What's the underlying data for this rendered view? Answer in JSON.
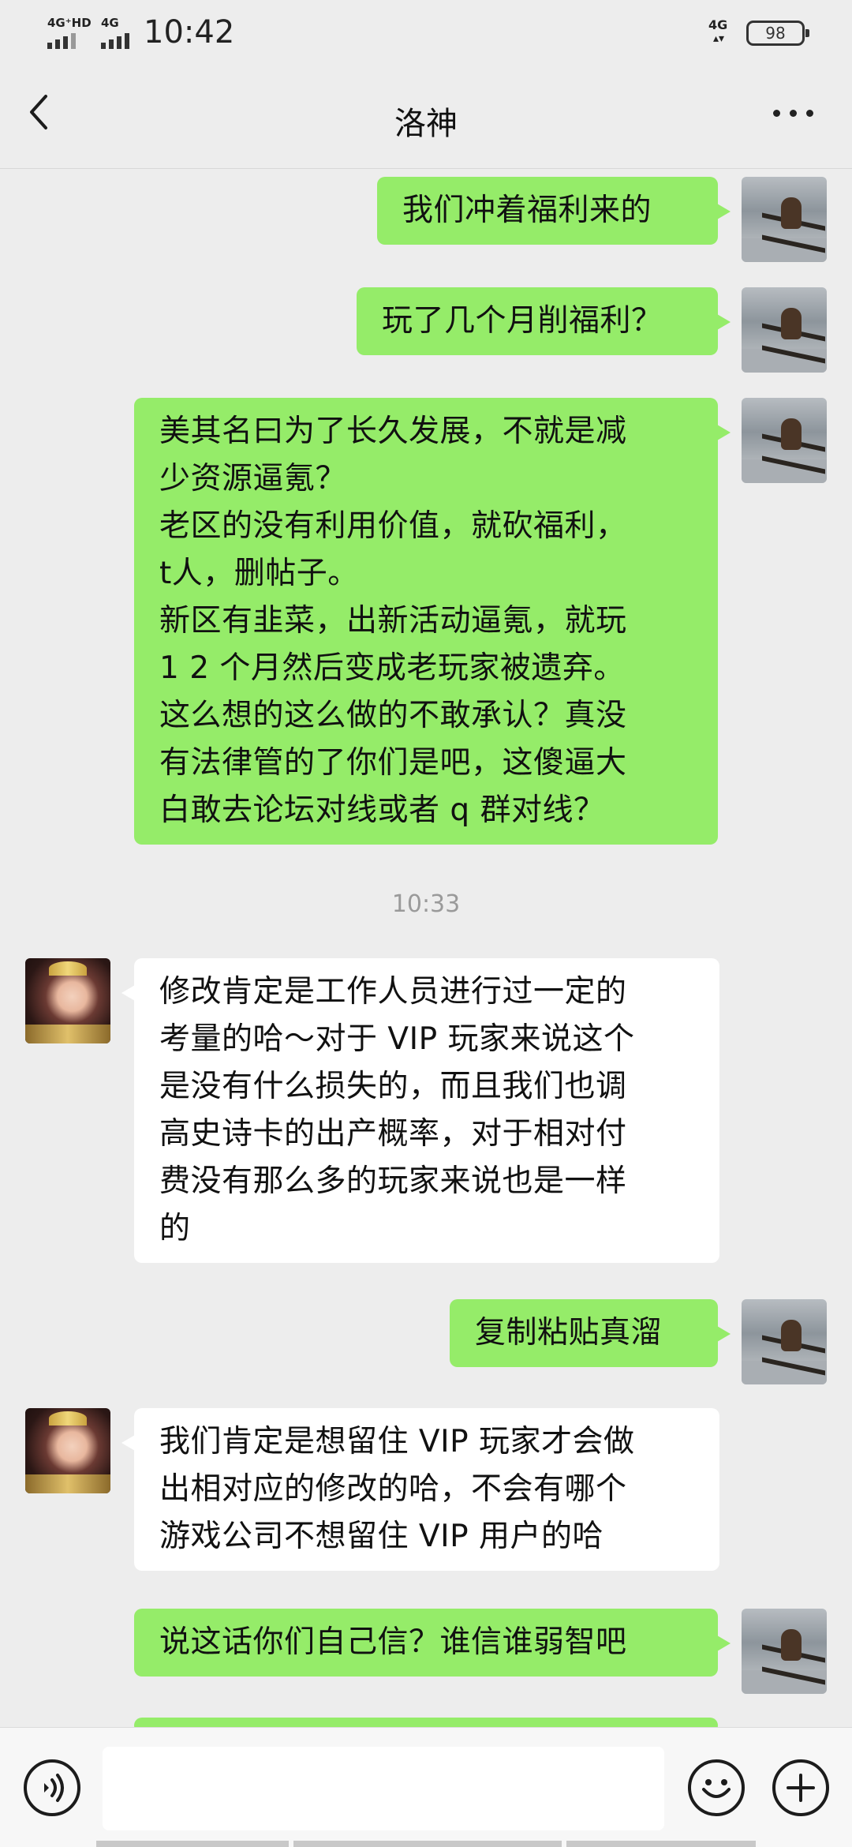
{
  "status_bar": {
    "sim1_label": "4G⁺HD",
    "sim2_label": "4G",
    "time": "10:42",
    "network_label": "4G",
    "battery": "98"
  },
  "header": {
    "title": "洛神",
    "back_icon": "chevron-left-icon",
    "more_icon": "more-dots-icon"
  },
  "colors": {
    "my_bubble": "#95ec69",
    "their_bubble": "#ffffff",
    "background": "#ededed"
  },
  "messages": [
    {
      "sender": "me",
      "lines": [
        "我们冲着福利来的"
      ]
    },
    {
      "sender": "me",
      "lines": [
        "玩了几个月削福利？"
      ]
    },
    {
      "sender": "me",
      "lines": [
        "美其名曰为了长久发展，不就是减",
        "少资源逼氪？",
        "老区的没有利用价值，就砍福利，",
        "t人，删帖子。",
        "新区有韭菜，出新活动逼氪，就玩",
        "1 2 个月然后变成老玩家被遗弃。",
        "这么想的这么做的不敢承认？真没",
        "有法律管的了你们是吧，这傻逼大",
        "白敢去论坛对线或者 q 群对线？"
      ]
    },
    {
      "sender": "them",
      "lines": [
        "修改肯定是工作人员进行过一定的",
        "考量的哈～对于 VIP 玩家来说这个",
        "是没有什么损失的，而且我们也调",
        "高史诗卡的出产概率，对于相对付",
        "费没有那么多的玩家来说也是一样",
        "的"
      ]
    },
    {
      "sender": "me",
      "lines": [
        "复制粘贴真溜"
      ]
    },
    {
      "sender": "them",
      "lines": [
        "我们肯定是想留住 VIP 玩家才会做",
        "出相对应的修改的哈，不会有哪个",
        "游戏公司不想留住 VIP 用户的哈"
      ]
    },
    {
      "sender": "me",
      "lines": [
        "说这话你们自己信？谁信谁弱智吧"
      ]
    }
  ],
  "timestamp": "10:33",
  "input_bar": {
    "voice_icon": "voice-icon",
    "text_value": "",
    "emoji_icon": "emoji-icon",
    "plus_icon": "plus-icon"
  }
}
